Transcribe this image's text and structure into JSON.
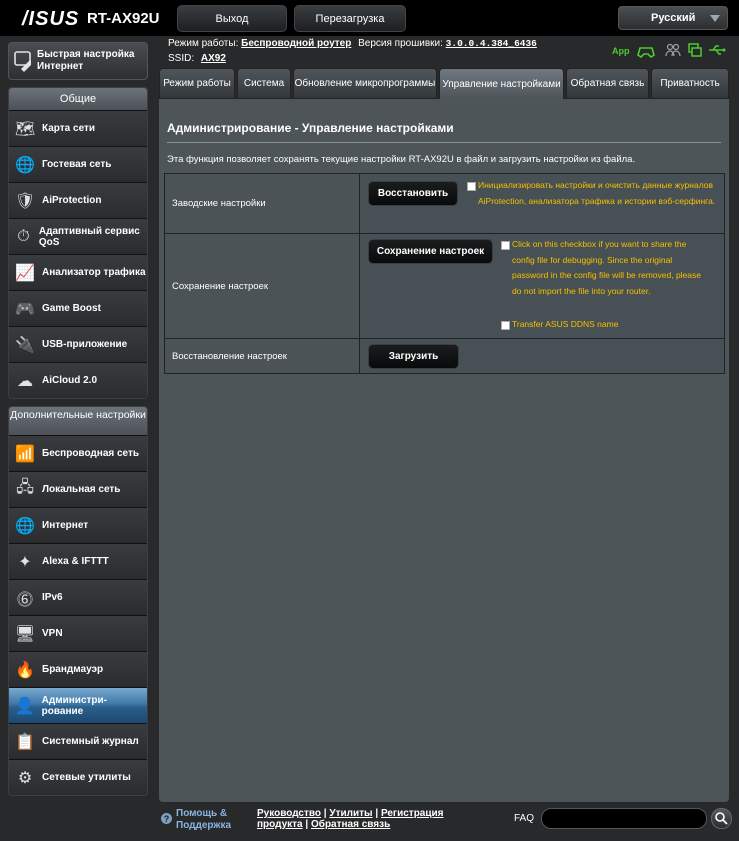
{
  "header": {
    "logo": "/ISUS",
    "model": "RT-AX92U",
    "logout_label": "Выход",
    "reboot_label": "Перезагрузка",
    "language": "Русский",
    "mode_label": "Режим работы:",
    "mode_value": "Беспроводной роутер",
    "firmware_label": "Версия прошивки:",
    "firmware_value": "3.0.0.4.384_6436",
    "ssid_label": "SSID:",
    "ssid_value": "AX92",
    "app_label": "App"
  },
  "sidebar": {
    "quick_setup": "Быстрая настройка Интернет",
    "general_header": "Общие",
    "general_items": [
      {
        "label": "Карта сети",
        "icon": "network-map-icon"
      },
      {
        "label": "Гостевая сеть",
        "icon": "guest-network-icon"
      },
      {
        "label": "AiProtection",
        "icon": "aiprotection-icon"
      },
      {
        "label": "Адаптивный сервис QoS",
        "icon": "qos-icon"
      },
      {
        "label": "Анализатор трафика",
        "icon": "traffic-analyzer-icon"
      },
      {
        "label": "Game Boost",
        "icon": "game-boost-icon"
      },
      {
        "label": "USB-приложение",
        "icon": "usb-app-icon"
      },
      {
        "label": "AiCloud 2.0",
        "icon": "aicloud-icon"
      }
    ],
    "advanced_header": "Дополнительные настройки",
    "advanced_items": [
      {
        "label": "Беспроводная сеть",
        "icon": "wireless-icon"
      },
      {
        "label": "Локальная сеть",
        "icon": "lan-icon"
      },
      {
        "label": "Интернет",
        "icon": "wan-icon"
      },
      {
        "label": "Alexa & IFTTT",
        "icon": "alexa-icon"
      },
      {
        "label": "IPv6",
        "icon": "ipv6-icon"
      },
      {
        "label": "VPN",
        "icon": "vpn-icon"
      },
      {
        "label": "Брандмауэр",
        "icon": "firewall-icon"
      },
      {
        "label": "Администри-рование",
        "icon": "administration-icon",
        "active": true
      },
      {
        "label": "Системный журнал",
        "icon": "system-log-icon"
      },
      {
        "label": "Сетевые утилиты",
        "icon": "network-tools-icon"
      }
    ]
  },
  "tabs": [
    {
      "label": "Режим работы"
    },
    {
      "label": "Система"
    },
    {
      "label": "Обновление микропрограммы"
    },
    {
      "label": "Управление настройками",
      "active": true
    },
    {
      "label": "Обратная связь"
    },
    {
      "label": "Приватность"
    }
  ],
  "main": {
    "title": "Администрирование - Управление настройками",
    "description": "Эта функция позволяет сохранять текущие настройки RT-AX92U в файл и загрузить настройки из файла.",
    "rows": [
      {
        "label": "Заводские настройки",
        "button": "Восстановить",
        "note": "Инициализировать настройки и очистить данные журналов AiProtection, анализатора трафика и истории вэб-серфинга."
      },
      {
        "label": "Сохранение настроек",
        "button": "Сохранение настроек",
        "note": "Click on this checkbox if you want to share the config file for debugging. Since the original password in the config file will be removed, please do not import the file into your router.",
        "note2": "Transfer ASUS DDNS name"
      },
      {
        "label": "Восстановление настроек",
        "button": "Загрузить"
      }
    ]
  },
  "footer": {
    "help": "Помощь & Поддержка",
    "manual": "Руководство",
    "utilities": "Утилиты",
    "registration": "Регистрация продукта",
    "feedback": "Обратная связь",
    "faq": "FAQ"
  }
}
